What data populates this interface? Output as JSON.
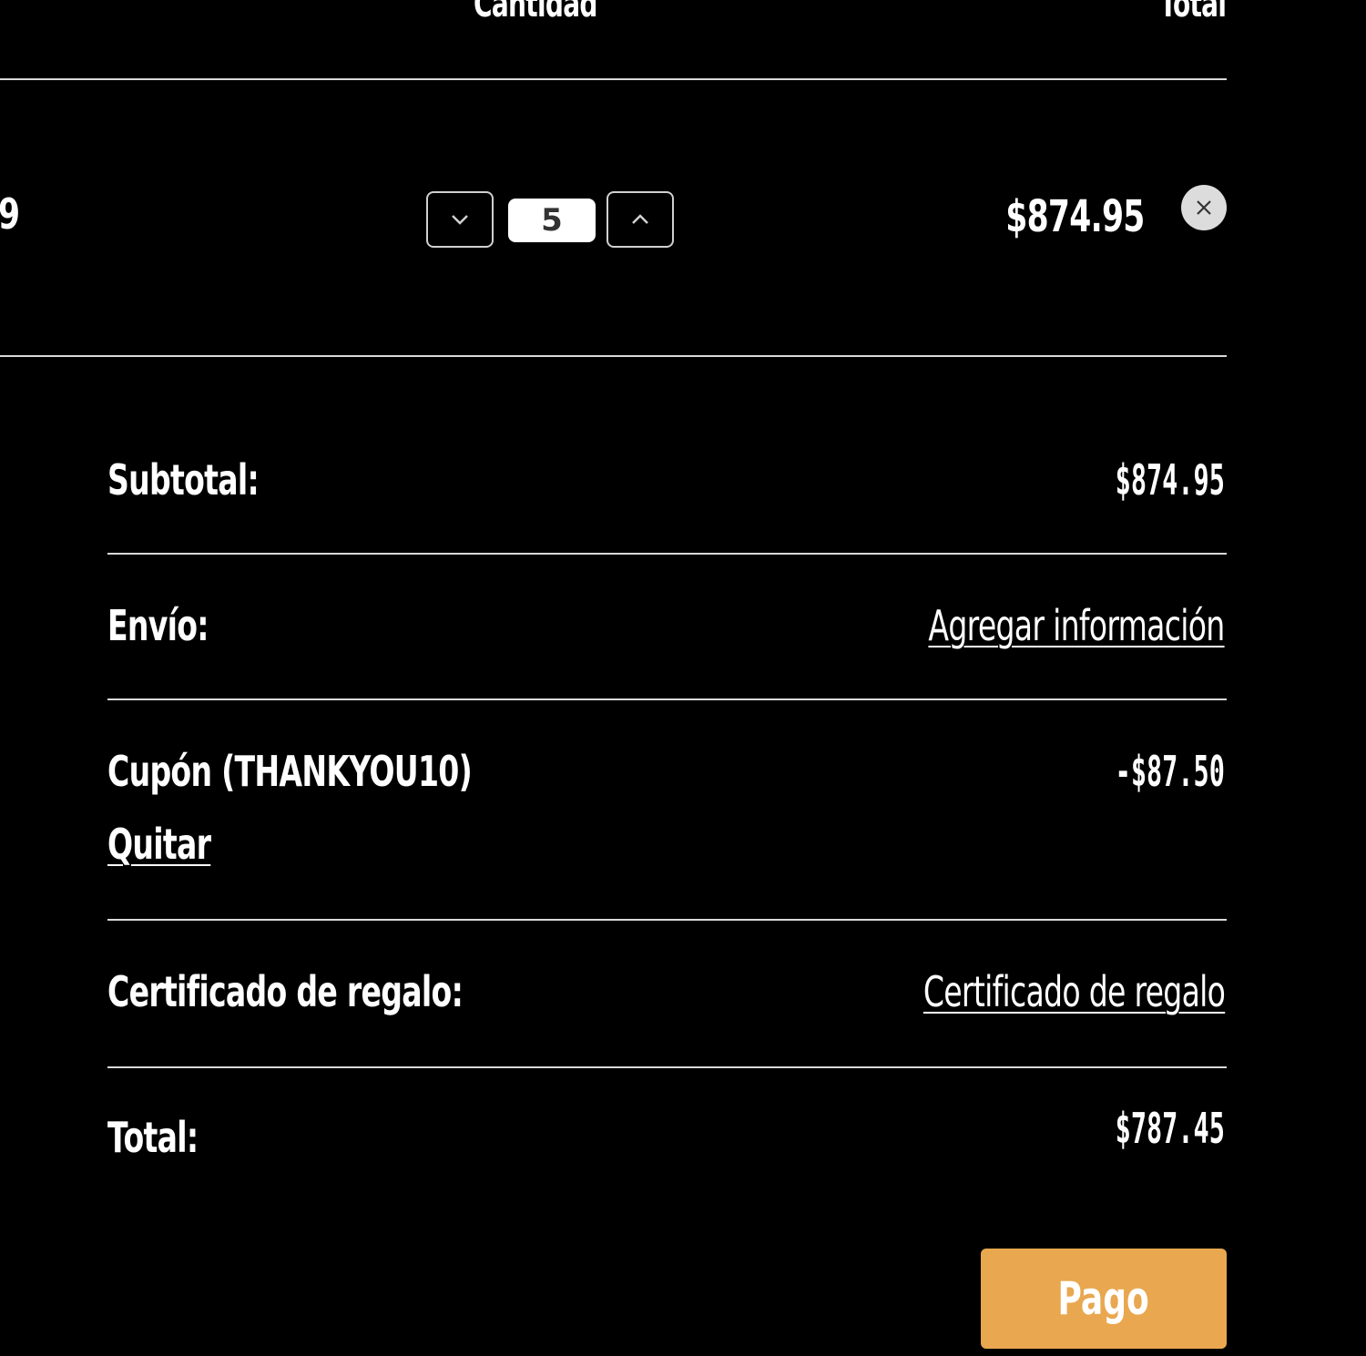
{
  "table_header": {
    "quantity": "Cantidad",
    "total": "Total"
  },
  "cart_item": {
    "price_fragment": "9",
    "quantity": "5",
    "line_total": "$874.95"
  },
  "summary": {
    "subtotal_label": "Subtotal:",
    "subtotal_value": "$874.95",
    "shipping_label": "Envío:",
    "shipping_link": "Agregar información",
    "coupon_label": "Cupón (THANKYOU10)",
    "coupon_value": "-$87.50",
    "coupon_remove": "Quitar",
    "gift_label": "Certificado de regalo:",
    "gift_link": "Certificado de regalo",
    "total_label": "Total:",
    "total_value": "$787.45"
  },
  "checkout": {
    "button_label": "Pago"
  },
  "icons": {
    "decrease": "chevron-down-icon",
    "increase": "chevron-up-icon",
    "remove": "close-icon"
  },
  "colors": {
    "background": "#000000",
    "text": "#ffffff",
    "accent": "#e9a74f",
    "divider": "#d9d9d9"
  }
}
